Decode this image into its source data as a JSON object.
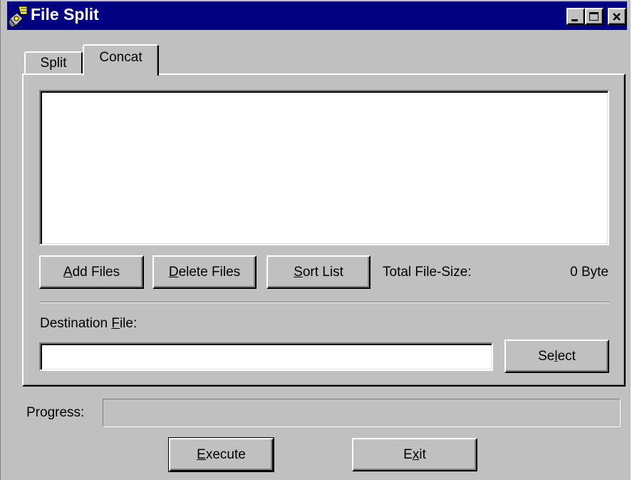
{
  "window": {
    "title": "File Split",
    "app_icon": "file-split-app-icon",
    "controls": {
      "minimize": "minimize-icon",
      "maximize": "maximize-icon",
      "close": "close-icon"
    }
  },
  "tabs": [
    {
      "label": "Split",
      "selected": false
    },
    {
      "label": "Concat",
      "selected": true
    }
  ],
  "concat": {
    "file_list_items": [],
    "add_files": {
      "pre": "",
      "accel": "A",
      "post": "dd Files"
    },
    "delete_files": {
      "pre": "",
      "accel": "D",
      "post": "elete Files"
    },
    "sort_list": {
      "pre": "",
      "accel": "S",
      "post": "ort List"
    },
    "total_size_label": "Total File-Size:",
    "total_size_value": "0 Byte",
    "destination_label": {
      "pre": "Destination ",
      "accel": "F",
      "post": "ile:"
    },
    "destination_value": "",
    "select": {
      "pre": "Se",
      "accel": "l",
      "post": "ect"
    }
  },
  "progress": {
    "label": "Progress:",
    "value": 0
  },
  "actions": {
    "execute": {
      "pre": "",
      "accel": "E",
      "post": "xecute"
    },
    "exit": {
      "pre": "E",
      "accel": "x",
      "post": "it"
    }
  },
  "colors": {
    "title_bar": "#000080",
    "face": "#c0c0c0",
    "shadow": "#808080",
    "highlight": "#ffffff"
  }
}
